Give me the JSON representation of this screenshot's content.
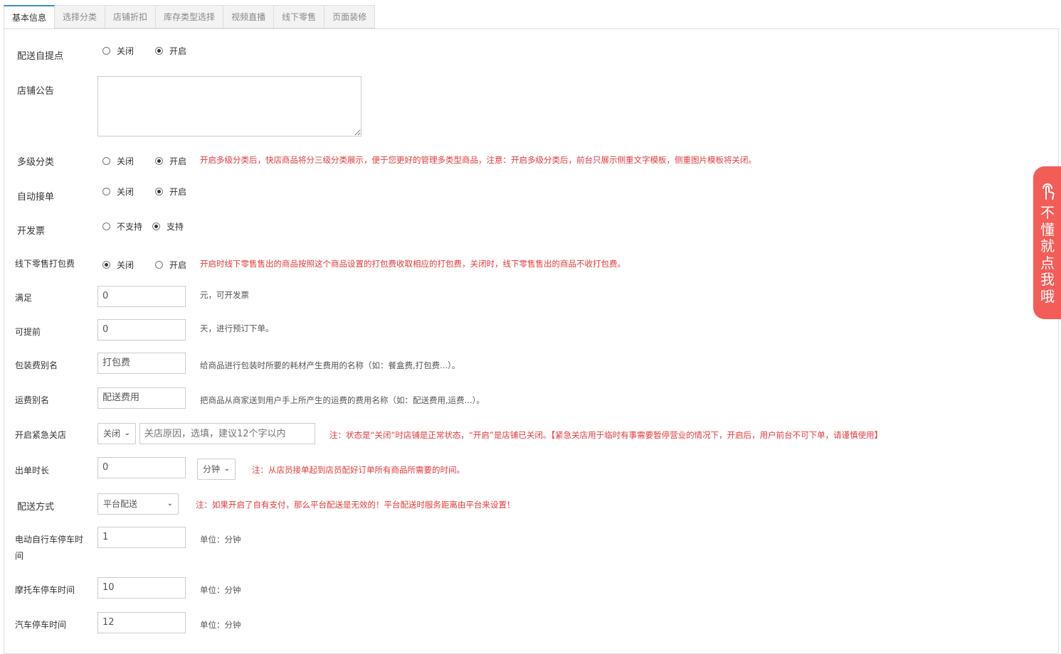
{
  "tabs": [
    "基本信息",
    "选择分类",
    "店铺折扣",
    "库存类型选择",
    "视频直播",
    "线下零售",
    "页面装修"
  ],
  "form": {
    "self_pickup": {
      "label": "配送自提点",
      "options": [
        "关闭",
        "开启"
      ],
      "selected": "开启"
    },
    "notice": {
      "label": "店铺公告",
      "value": ""
    },
    "multi_category": {
      "label": "多级分类",
      "options": [
        "关闭",
        "开启"
      ],
      "selected": "开启",
      "hint": "开启多级分类后，快店商品将分三级分类展示，便于您更好的管理多类型商品，注意：开启多级分类后，前台只展示侧重文字模板，侧重图片模板将关闭。"
    },
    "auto_accept": {
      "label": "自动接单",
      "options": [
        "关闭",
        "开启"
      ],
      "selected": "开启"
    },
    "invoice": {
      "label": "开发票",
      "options": [
        "不支持",
        "支持"
      ],
      "selected": "支持"
    },
    "offline_pack_fee": {
      "label": "线下零售打包费",
      "options": [
        "关闭",
        "开启"
      ],
      "selected": "关闭",
      "hint": "开启时线下零售售出的商品按照这个商品设置的打包费收取相应的打包费，关闭时，线下零售售出的商品不收打包费。"
    },
    "min_amount": {
      "label": "满足",
      "value": "0",
      "hint": "元，可开发票"
    },
    "advance_days": {
      "label": "可提前",
      "value": "0",
      "hint": "天，进行预订下单。"
    },
    "pack_alias": {
      "label": "包装费别名",
      "value": "打包费",
      "hint": "给商品进行包装时所要的耗材产生费用的名称（如：餐盒费,打包费...）。"
    },
    "freight_alias": {
      "label": "运费别名",
      "value": "配送费用",
      "hint": "把商品从商家送到用户手上所产生的运费的费用名称（如：配送费用,运费...）。"
    },
    "emergency_close": {
      "label": "开启紧急关店",
      "select": "关闭",
      "reason_placeholder": "关店原因，选填，建议12个字以内",
      "hint": "注：状态是“关闭”时店铺是正常状态，“开启”是店铺已关闭。【紧急关店用于临时有事需要暂停营业的情况下，开启后，用户前台不可下单，请谨慎使用】"
    },
    "prep_time": {
      "label": "出单时长",
      "value": "0",
      "unit": "分钟",
      "hint": "注：从店员接单起到店员配好订单所有商品所需要的时间。"
    },
    "delivery_method": {
      "label": "配送方式",
      "select": "平台配送",
      "hint": "注：如果开启了自有支付，那么平台配送是无效的！平台配送时服务距离由平台来设置！"
    },
    "ebike_parking": {
      "label_line1": "电动自行车停车时",
      "label_line2": "间",
      "value": "1",
      "hint": "单位：分钟"
    },
    "moto_parking": {
      "label": "摩托车停车时间",
      "value": "10",
      "hint": "单位：分钟"
    },
    "car_parking": {
      "label": "汽车停车时间",
      "value": "12",
      "hint": "单位：分钟"
    }
  },
  "side_help": {
    "text": "不懂就点我哦",
    "icon": "hand-pointer-icon"
  },
  "colors": {
    "accent_tab": "#3c8dbc",
    "hint_red": "#e4393c",
    "side_help_bg": "#f25d58"
  }
}
